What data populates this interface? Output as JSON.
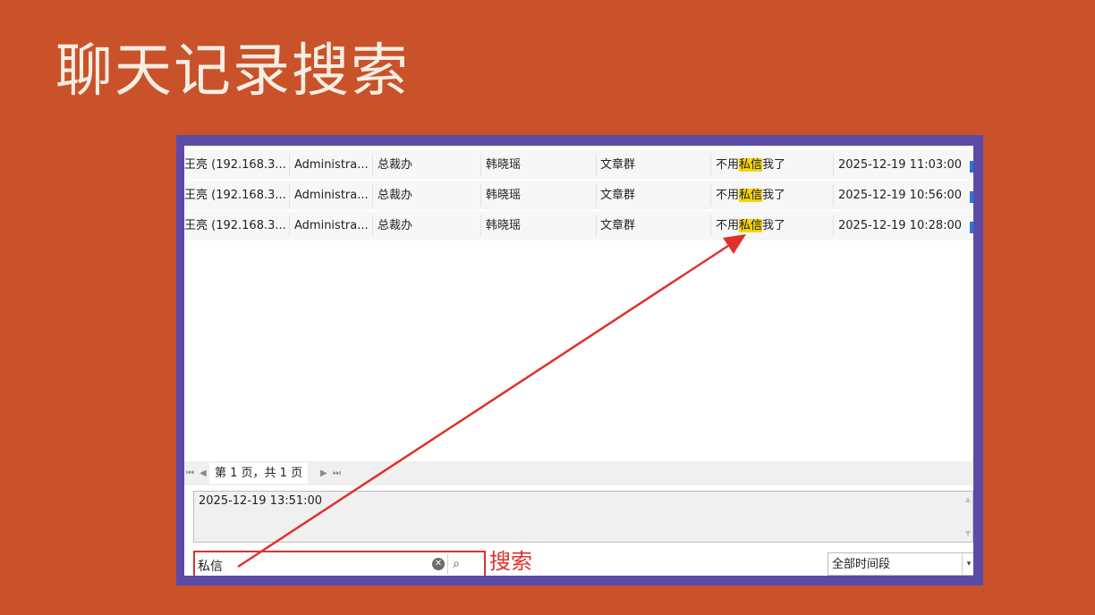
{
  "slide": {
    "title": "聊天记录搜索"
  },
  "table": {
    "rows": [
      {
        "sender": "王亮 (192.168.3...",
        "account": "Administra...",
        "dept": "总裁办",
        "receiver": "韩晓瑶",
        "group": "文章群",
        "msg_before": "不用",
        "msg_hl": "私信",
        "msg_after": "我了",
        "time": "2025-12-19 11:03:00"
      },
      {
        "sender": "王亮 (192.168.3...",
        "account": "Administra...",
        "dept": "总裁办",
        "receiver": "韩晓瑶",
        "group": "文章群",
        "msg_before": "不用",
        "msg_hl": "私信",
        "msg_after": "我了",
        "time": "2025-12-19 10:56:00"
      },
      {
        "sender": "王亮 (192.168.3...",
        "account": "Administra...",
        "dept": "总裁办",
        "receiver": "韩晓瑶",
        "group": "文章群",
        "msg_before": "不用",
        "msg_hl": "私信",
        "msg_after": "我了",
        "time": "2025-12-19 10:28:00"
      }
    ]
  },
  "pager": {
    "first": "⏮",
    "prev": "◀",
    "label": "第 1 页，共 1 页",
    "next": "▶",
    "last": "⏭"
  },
  "preview": {
    "timestamp": "2025-12-19 13:51:00",
    "scroll_up": "▲",
    "scroll_down": "▼"
  },
  "search": {
    "value": "私信",
    "clear_icon": "✕",
    "search_icon": "⌕",
    "caption": "搜索"
  },
  "time_filter": {
    "value": "全部时间段",
    "arrow": "▾"
  },
  "colors": {
    "background": "#C9522B",
    "frame": "#5B4BA7",
    "highlight": "#F5D40A",
    "annotation": "#E0302A"
  }
}
